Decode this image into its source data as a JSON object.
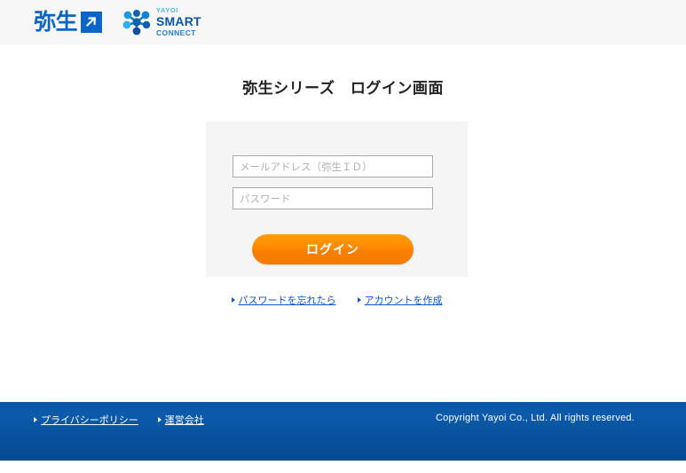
{
  "header": {
    "brand": {
      "name": "弥生",
      "mark_icon": "arrow-up-right-icon"
    },
    "product_logo": {
      "nodes_icon": "network-nodes-icon",
      "line1": "YAYOI",
      "line2": "SMART",
      "line3": "CONNECT"
    }
  },
  "main": {
    "page_title": "弥生シリーズ　ログイン画面",
    "form": {
      "email_placeholder": "メールアドレス（弥生ＩＤ）",
      "email_value": "",
      "password_placeholder": "パスワード",
      "password_value": "",
      "login_button_label": "ログイン"
    },
    "sub_links": [
      {
        "label": "パスワードを忘れたら",
        "bullet_icon": "triangle-right-icon"
      },
      {
        "label": "アカウントを作成",
        "bullet_icon": "triangle-right-icon"
      }
    ]
  },
  "footer": {
    "links": [
      {
        "label": "プライバシーポリシー",
        "bullet_icon": "triangle-right-icon"
      },
      {
        "label": "運営会社",
        "bullet_icon": "triangle-right-icon"
      }
    ],
    "copyright": "Copyright Yayoi Co., Ltd. All rights reserved."
  },
  "colors": {
    "brand_blue": "#0b64c8",
    "footer_blue": "#0a55a2",
    "accent_orange": "#ff8a00",
    "link_blue": "#1155cc",
    "panel_gray": "#f5f5f5",
    "header_gray": "#f7f7f7"
  }
}
